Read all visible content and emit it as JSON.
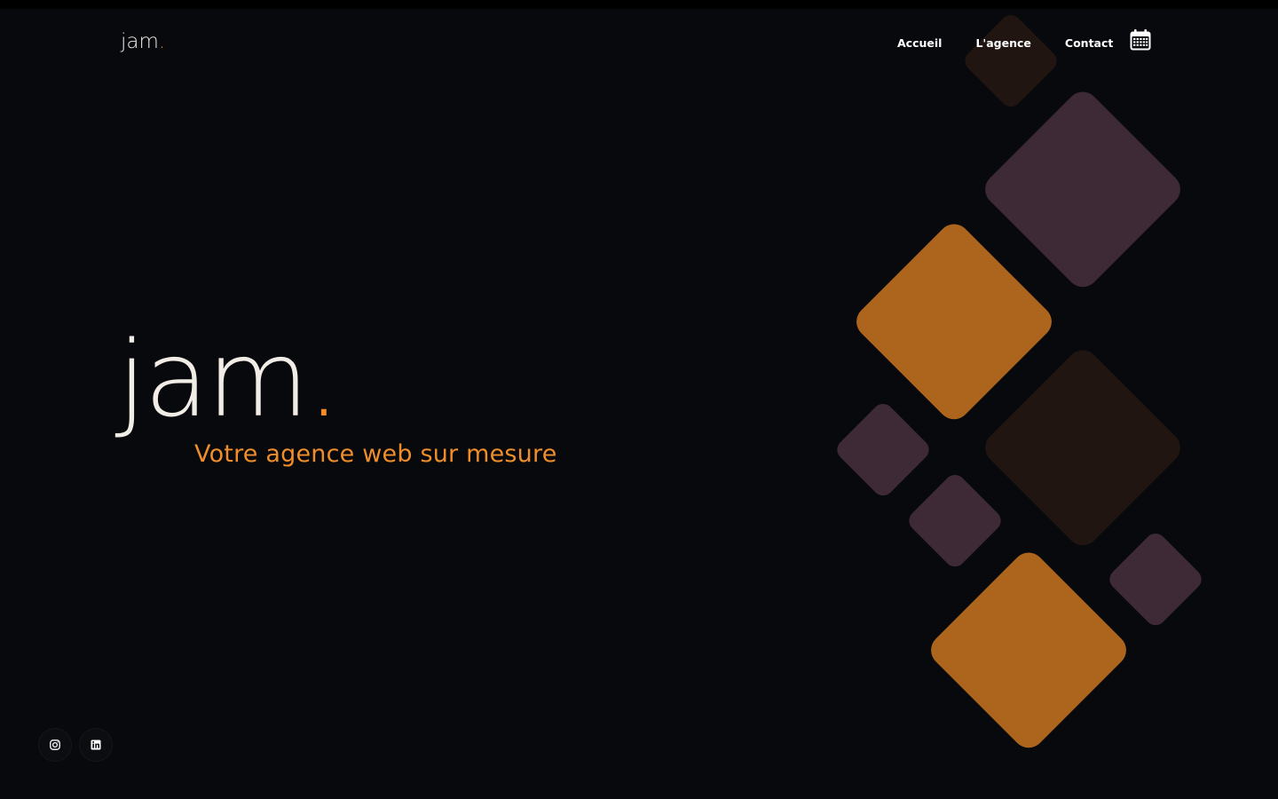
{
  "header": {
    "logo_text": "jam",
    "logo_dot": ".",
    "nav": [
      {
        "label": "Accueil"
      },
      {
        "label": "L'agence"
      },
      {
        "label": "Contact"
      }
    ],
    "calendar_icon": "calendar-icon"
  },
  "hero": {
    "logo_text_j": "j",
    "logo_text_rest": "am",
    "logo_dot": ".",
    "tagline": "Votre agence web sur mesure"
  },
  "social": [
    {
      "icon": "instagram-icon"
    },
    {
      "icon": "linkedin-icon"
    }
  ],
  "colors": {
    "background": "#07090d",
    "accent": "#f08d2b",
    "orange_tile": "#ad641d",
    "purple_tile": "#3e2a36",
    "brown_tile": "#201510",
    "logo": "#f2ece6"
  }
}
